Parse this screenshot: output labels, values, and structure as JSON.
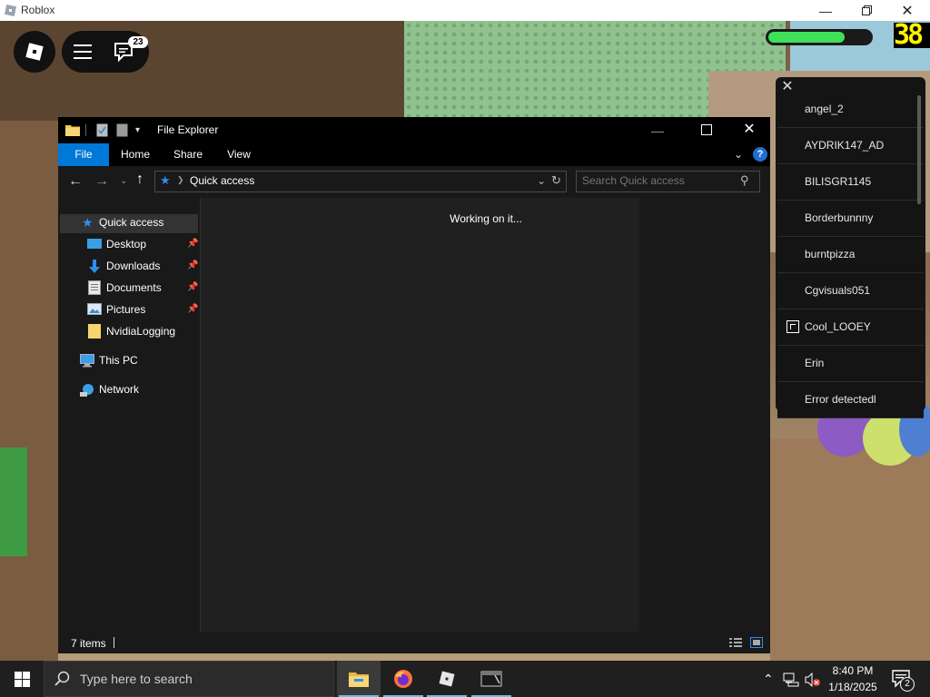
{
  "window": {
    "title": "Roblox"
  },
  "hud": {
    "chat_badge": "23",
    "counter": "38"
  },
  "player_list": {
    "players": [
      "angel_2",
      "AYDRIK147_AD",
      "BILISGR1145",
      "Borderbunnny",
      "burntpizza",
      "Cgvisuals051",
      "Cool_LOOEY",
      "Erin",
      "Error detectedl"
    ]
  },
  "explorer": {
    "title": "File Explorer",
    "tabs": [
      "File",
      "Home",
      "Share",
      "View"
    ],
    "address": "Quick access",
    "search_placeholder": "Search Quick access",
    "nav": {
      "quick_access": "Quick access",
      "items": [
        "Desktop",
        "Downloads",
        "Documents",
        "Pictures",
        "NvidiaLogging"
      ],
      "this_pc": "This PC",
      "network": "Network"
    },
    "content_message": "Working on it...",
    "status": "7 items"
  },
  "taskbar": {
    "search_placeholder": "Type here to search",
    "time": "8:40 PM",
    "date": "1/18/2025",
    "notification_count": "2"
  },
  "colors": {
    "accent": "#0078d7",
    "health": "#3fe05a",
    "counter": "#fff200"
  }
}
